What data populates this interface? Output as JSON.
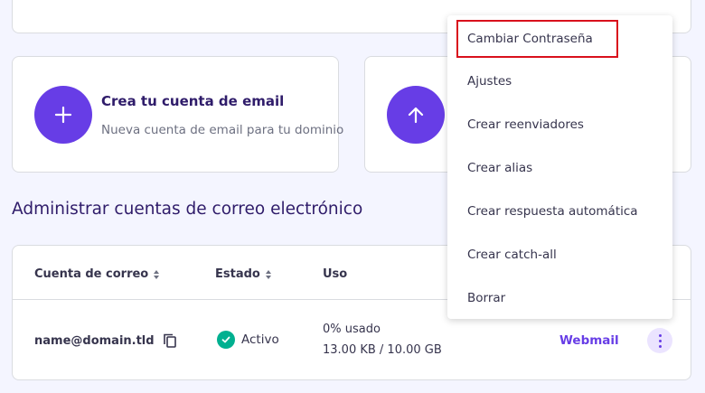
{
  "cards": {
    "create_email": {
      "title": "Crea tu cuenta de email",
      "subtitle": "Nueva cuenta de email para tu dominio",
      "icon": "plus-icon"
    },
    "upload": {
      "icon": "arrow-up-icon"
    }
  },
  "section": {
    "title": "Administrar cuentas de correo electrónico"
  },
  "table": {
    "headers": {
      "email": "Cuenta de correo",
      "status": "Estado",
      "usage": "Uso"
    },
    "rows": [
      {
        "email": "name@domain.tld",
        "status": "Activo",
        "usage_percent": "0% usado",
        "usage_size": "13.00 KB / 10.00 GB",
        "action": "Webmail"
      }
    ]
  },
  "menu": {
    "items": [
      "Cambiar Contraseña",
      "Ajustes",
      "Crear reenviadores",
      "Crear alias",
      "Crear respuesta automática",
      "Crear catch-all",
      "Borrar"
    ],
    "highlighted_index": 0
  },
  "colors": {
    "accent": "#673de6",
    "success": "#00b090",
    "highlight": "#d9101c"
  }
}
